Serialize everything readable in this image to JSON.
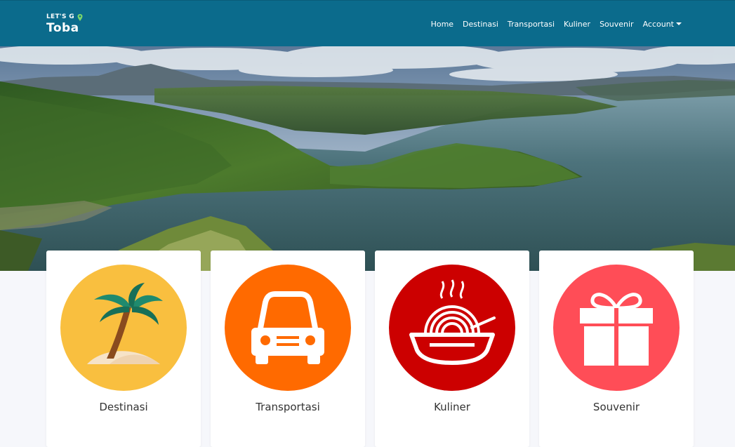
{
  "brand": {
    "logo_top": "LET'S G",
    "logo_bottom": "Toba"
  },
  "nav": {
    "items": [
      {
        "label": "Home"
      },
      {
        "label": "Destinasi"
      },
      {
        "label": "Transportasi"
      },
      {
        "label": "Kuliner"
      },
      {
        "label": "Souvenir"
      }
    ],
    "account_label": "Account"
  },
  "categories": [
    {
      "label": "Destinasi",
      "icon": "palm-tree-icon",
      "color": "#f9bf3f"
    },
    {
      "label": "Transportasi",
      "icon": "car-icon",
      "color": "#ff6a00"
    },
    {
      "label": "Kuliner",
      "icon": "noodle-bowl-icon",
      "color": "#cc0000"
    },
    {
      "label": "Souvenir",
      "icon": "gift-icon",
      "color": "#ff4d57"
    }
  ],
  "colors": {
    "navbar": "#0b6b8c",
    "page_background": "#f6f7fb",
    "card_background": "#ffffff"
  }
}
